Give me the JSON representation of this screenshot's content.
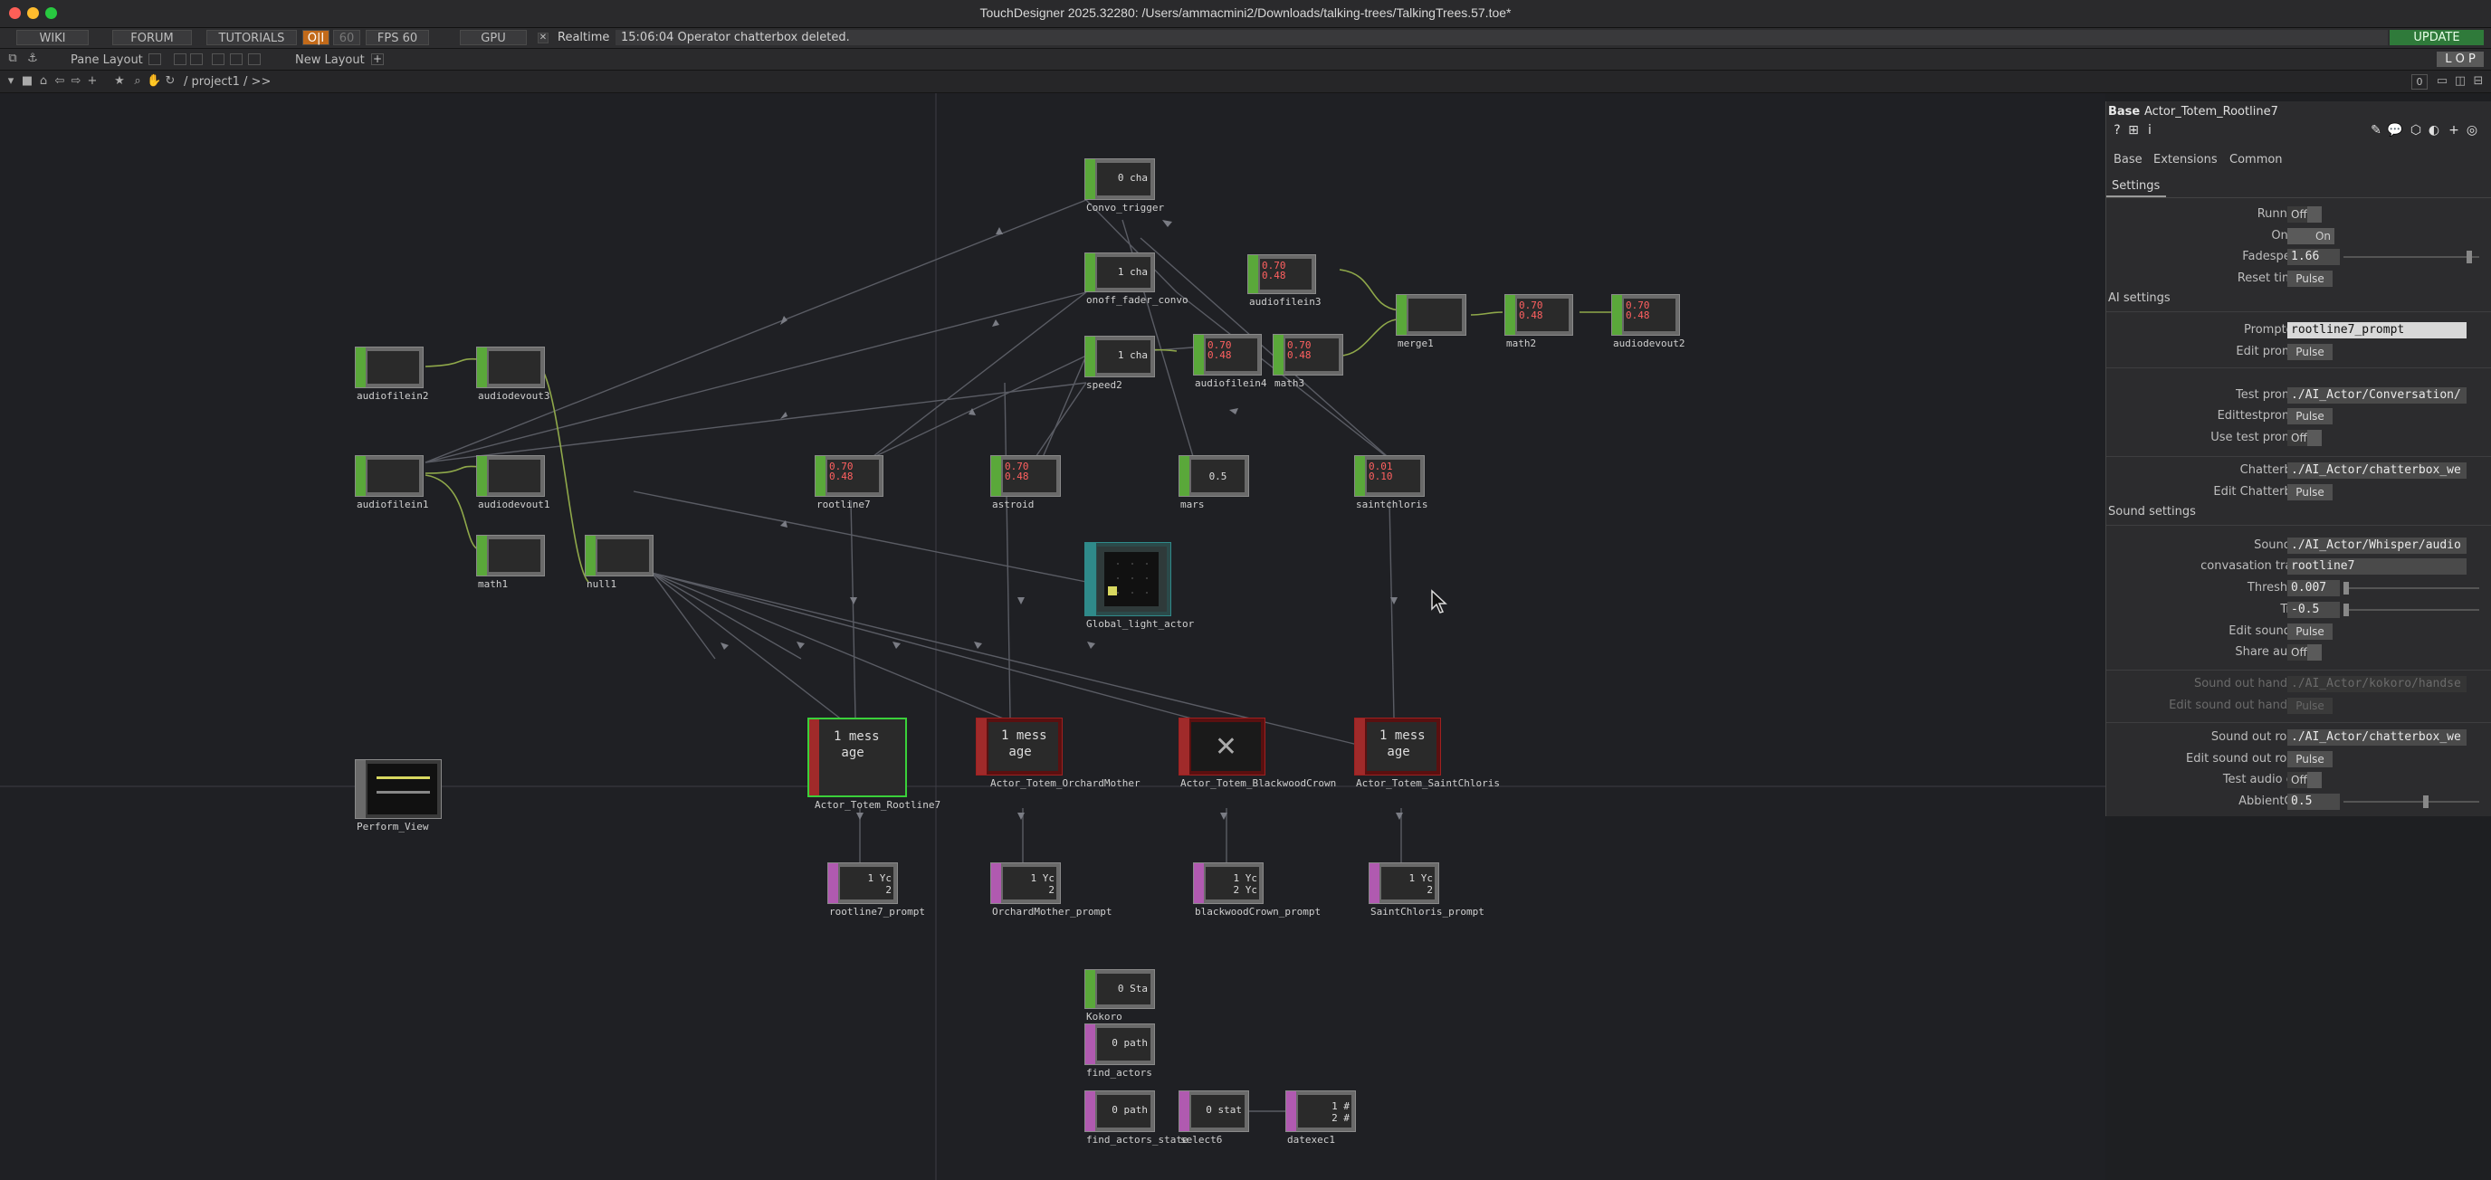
{
  "window": {
    "title": "TouchDesigner 2025.32280: /Users/ammacmini2/Downloads/talking-trees/TalkingTrees.57.toe*"
  },
  "menubar": {
    "wiki": "WIKI",
    "forum": "FORUM",
    "tutorials": "TUTORIALS",
    "oi": "O|I",
    "fps_cap": "60",
    "fps_label": "FPS 60",
    "gpu": "GPU",
    "realtime_label": "Realtime",
    "status_message": "15:06:04 Operator chatterbox deleted.",
    "update": "UPDATE"
  },
  "layoutbar": {
    "pane_layout": "Pane Layout",
    "new_layout": "New Layout",
    "add": "+",
    "lop": "L O P"
  },
  "pathbar": {
    "path": "/ project1 / >>",
    "counter": "0"
  },
  "nodes": [
    {
      "id": "convo_trigger",
      "label": "Convo_trigger",
      "preview": "0 cha"
    },
    {
      "id": "onoff_fader",
      "label": "onoff_fader_convo",
      "preview": "1 cha"
    },
    {
      "id": "speed2",
      "label": "speed2",
      "preview": "1 cha"
    },
    {
      "id": "audiofilein3",
      "label": "audiofilein3",
      "preview": "0.70\n0.48"
    },
    {
      "id": "audiofilein4",
      "label": "audiofilein4",
      "preview": "0.70\n0.48"
    },
    {
      "id": "math3",
      "label": "math3",
      "preview": "0.70\n0.48"
    },
    {
      "id": "merge1",
      "label": "merge1",
      "preview": ""
    },
    {
      "id": "math2",
      "label": "math2",
      "preview": "0.70\n0.48"
    },
    {
      "id": "audiodevout2",
      "label": "audiodevout2",
      "preview": "0.70\n0.48"
    },
    {
      "id": "audiofilein2",
      "label": "audiofilein2",
      "preview": ""
    },
    {
      "id": "audiodevout3",
      "label": "audiodevout3",
      "preview": ""
    },
    {
      "id": "audiofilein1",
      "label": "audiofilein1",
      "preview": ""
    },
    {
      "id": "audiodevout1",
      "label": "audiodevout1",
      "preview": ""
    },
    {
      "id": "math1",
      "label": "math1",
      "preview": ""
    },
    {
      "id": "null1",
      "label": "null1",
      "preview": ""
    },
    {
      "id": "rootline7",
      "label": "rootline7",
      "preview": "0.70\n0.48"
    },
    {
      "id": "astroid",
      "label": "astroid",
      "preview": "0.70\n0.48"
    },
    {
      "id": "mars",
      "label": "mars",
      "preview": "0.5"
    },
    {
      "id": "saintchloris",
      "label": "saintchloris",
      "preview": "0.01\n0.10"
    },
    {
      "id": "global_light_actor",
      "label": "Global_light_actor",
      "preview": ""
    },
    {
      "id": "actor_rootline7",
      "label": "Actor_Totem_Rootline7",
      "preview": "1 mess\n age"
    },
    {
      "id": "actor_orchardmother",
      "label": "Actor_Totem_OrchardMother",
      "preview": "1 mess\n age"
    },
    {
      "id": "actor_blackwoodcrown",
      "label": "Actor_Totem_BlackwoodCrown",
      "preview": ""
    },
    {
      "id": "actor_saintchloris",
      "label": "Actor_Totem_SaintChloris",
      "preview": "1 mess\n age"
    },
    {
      "id": "perform_view",
      "label": "Perform_View",
      "preview": ""
    },
    {
      "id": "rootline7_prompt",
      "label": "rootline7_prompt",
      "preview": "1 Yc\n 2"
    },
    {
      "id": "orchardmother_prompt",
      "label": "OrchardMother_prompt",
      "preview": "1 Yc\n 2"
    },
    {
      "id": "blackwoodcrown_prompt",
      "label": "blackwoodCrown_prompt",
      "preview": "1 Yc\n 2 Yc"
    },
    {
      "id": "saintchloris_prompt",
      "label": "SaintChloris_prompt",
      "preview": "1 Yc\n 2"
    },
    {
      "id": "kokoro",
      "label": "Kokoro",
      "preview": "0 Sta"
    },
    {
      "id": "find_actors",
      "label": "find_actors",
      "preview": "0 path"
    },
    {
      "id": "find_actors_state",
      "label": "find_actors_state",
      "preview": "0 path"
    },
    {
      "id": "select6",
      "label": "select6",
      "preview": "0 stat"
    },
    {
      "id": "datexec1",
      "label": "datexec1",
      "preview": "1 #\n 2 #"
    }
  ],
  "panel": {
    "type": "Base",
    "name": "Actor_Totem_Rootline7",
    "tabs": [
      "Base",
      "Extensions",
      "Common"
    ],
    "subtab": "Settings",
    "params": {
      "running": {
        "label": "Running",
        "value": "Off"
      },
      "onoff": {
        "label": "OnOff",
        "value": "On"
      },
      "fadespeed": {
        "label": "Fadespeed",
        "value": "1.66"
      },
      "reset_timer": {
        "label": "Reset timer",
        "value": "Pulse"
      },
      "ai_settings": "AI settings",
      "promptdat": {
        "label": "Promptdat",
        "value": "rootline7_prompt"
      },
      "edit_prompt": {
        "label": "Edit prompt",
        "value": "Pulse"
      },
      "test_prompt": {
        "label": "Test prompt",
        "value": "./AI_Actor/Conversation/"
      },
      "edittestprompt": {
        "label": "Edittestprompt",
        "value": "Pulse"
      },
      "use_test_prompt": {
        "label": "Use test prompt",
        "value": "Off"
      },
      "chatterbox": {
        "label": "Chatterbox",
        "value": "./AI_Actor/chatterbox_we"
      },
      "edit_chatterbox": {
        "label": "Edit Chatterbox",
        "value": "Pulse"
      },
      "sound_settings": "Sound settings",
      "sound_in": {
        "label": "Sound in",
        "value": "./AI_Actor/Whisper/audio"
      },
      "convasation_track": {
        "label": "convasation track",
        "value": "rootline7"
      },
      "threshold": {
        "label": "Threshold",
        "value": "0.007"
      },
      "trim": {
        "label": "Trim",
        "value": "-0.5"
      },
      "edit_sound_in": {
        "label": "Edit sound in",
        "value": "Pulse"
      },
      "share_audio": {
        "label": "Share audio",
        "value": "Off"
      },
      "sound_out_handset": {
        "label": "Sound out handset",
        "value": "./AI_Actor/kokoro/handse"
      },
      "edit_sound_out_handset": {
        "label": "Edit sound out handset",
        "value": "Pulse"
      },
      "sound_out_room": {
        "label": "Sound out room",
        "value": "./AI_Actor/chatterbox_we"
      },
      "edit_sound_out_room": {
        "label": "Edit sound out room",
        "value": "Pulse"
      },
      "test_audio_out": {
        "label": "Test audio out",
        "value": "Off"
      },
      "abbientout": {
        "label": "AbbientOut",
        "value": "0.5"
      }
    }
  },
  "colors": {
    "accent_green": "#5aa83a",
    "dat_purple": "#b05ab0",
    "comp_red": "#a02a2a",
    "update_green": "#2f7a3a"
  }
}
